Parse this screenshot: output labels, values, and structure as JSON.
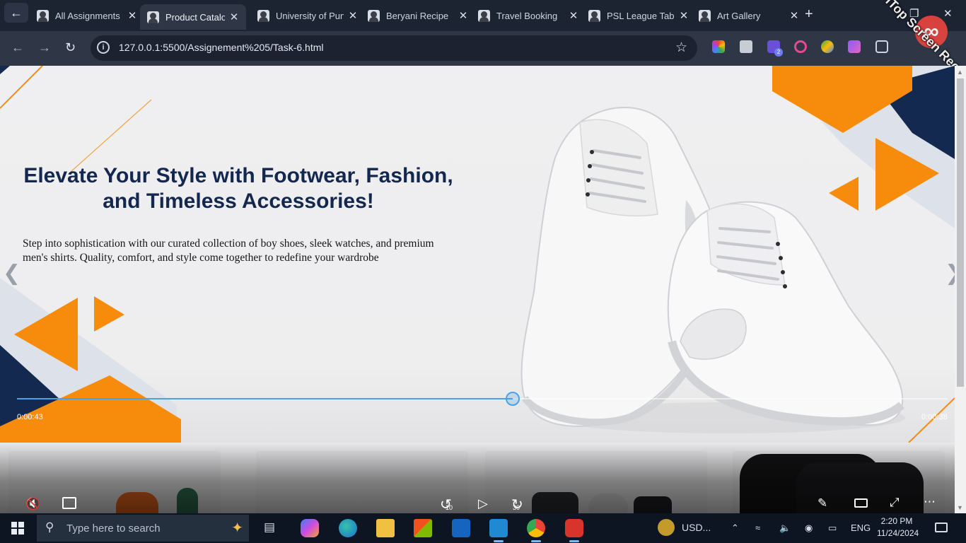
{
  "browser": {
    "tabs": [
      {
        "title": "All Assignments",
        "active": false
      },
      {
        "title": "Product Catalog",
        "active": true
      },
      {
        "title": "University of Punjab",
        "active": false
      },
      {
        "title": "Beryani Recipe",
        "active": false
      },
      {
        "title": "Travel Booking",
        "active": false
      },
      {
        "title": "PSL League Table",
        "active": false
      },
      {
        "title": "Art Gallery",
        "active": false
      }
    ],
    "url": "127.0.0.1:5500/Assignement%205/Task-6.html",
    "extension_badge": "2"
  },
  "watermark": {
    "text": "iTop Screen Recorder"
  },
  "hero": {
    "title_line1": "Elevate Your Style with Footwear, Fashion,",
    "title_line2": "and Timeless Accessories!",
    "description": "Step into sophistication with our curated collection of boy shoes, sleek watches, and premium men's shirts. Quality, comfort, and style come together to redefine your wardrobe",
    "colors": {
      "navy": "#13294f",
      "orange": "#f78c0c",
      "background": "#eeeeef"
    }
  },
  "video": {
    "elapsed": "0:00:43",
    "remaining": "0:00:38",
    "progress": 0.533,
    "skip_back": "10",
    "skip_forward": "30"
  },
  "taskbar": {
    "search_placeholder": "Type here to search",
    "currency": "USD...",
    "language": "ENG",
    "time": "2:20 PM",
    "date": "11/24/2024"
  }
}
